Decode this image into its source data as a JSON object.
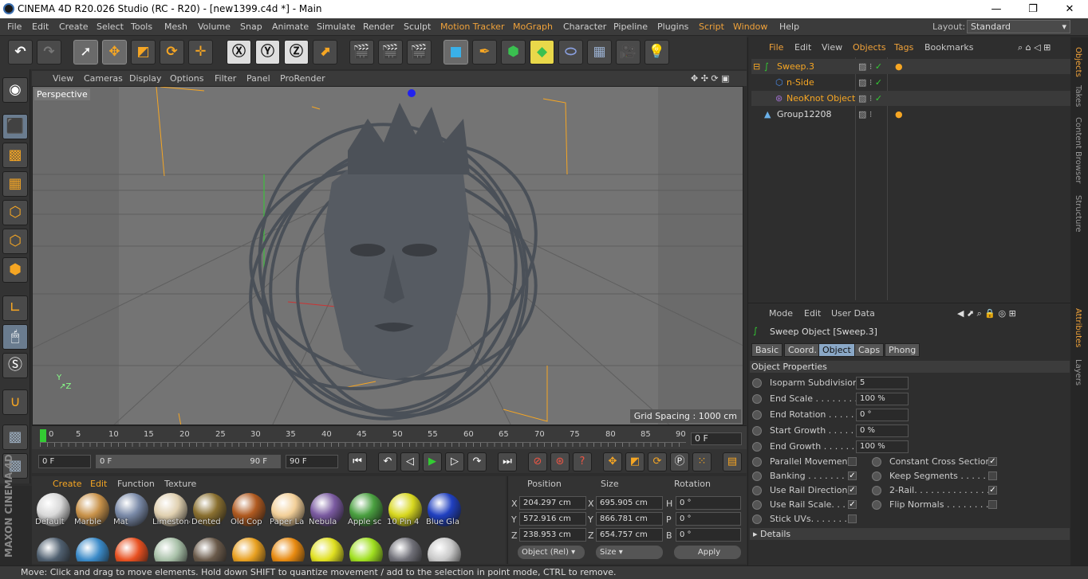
{
  "window": {
    "title": "CINEMA 4D R20.026 Studio (RC - R20) - [new1399.c4d *] - Main",
    "minimize": "—",
    "maximize": "❐",
    "close": "✕"
  },
  "menu": {
    "items": [
      "File",
      "Edit",
      "Create",
      "Select",
      "Tools",
      "Mesh",
      "Volume",
      "Snap",
      "Animate",
      "Simulate",
      "Render",
      "Sculpt",
      "Motion Tracker",
      "MoGraph",
      "Character",
      "Pipeline",
      "Plugins",
      "Script",
      "Window",
      "Help"
    ],
    "layout_label": "Layout:",
    "layout_value": "Standard"
  },
  "viewport": {
    "menu": [
      "View",
      "Cameras",
      "Display",
      "Options",
      "Filter",
      "Panel",
      "ProRender"
    ],
    "camera": "Perspective",
    "grid_spacing": "Grid Spacing : 1000 cm"
  },
  "timeline": {
    "ticks": [
      "0",
      "5",
      "10",
      "15",
      "20",
      "25",
      "30",
      "35",
      "40",
      "45",
      "50",
      "55",
      "60",
      "65",
      "70",
      "75",
      "80",
      "85",
      "90"
    ],
    "current_frame": "0 F"
  },
  "transport": {
    "start": "0 F",
    "range_start": "0 F",
    "range_end": "90 F",
    "end": "90 F"
  },
  "materials": {
    "menu": [
      "Create",
      "Edit",
      "Function",
      "Texture"
    ],
    "row1": [
      {
        "name": "Default",
        "color": "#d8d8d8"
      },
      {
        "name": "Marble",
        "color": "#c8924a"
      },
      {
        "name": "Mat",
        "color": "#7a8aa8"
      },
      {
        "name": "Limestone",
        "color": "#e0d0b0"
      },
      {
        "name": "Dented",
        "color": "#8a7030"
      },
      {
        "name": "Old Cop",
        "color": "#b05a20"
      },
      {
        "name": "Paper La",
        "color": "#f2cf98"
      },
      {
        "name": "Nebula",
        "color": "#7a5aa0"
      },
      {
        "name": "Apple sc",
        "color": "#4aa040"
      },
      {
        "name": "10 Pin 4",
        "color": "#d8d820"
      },
      {
        "name": "Blue Gla",
        "color": "#2040c0"
      }
    ],
    "row2": [
      {
        "color": "#506070"
      },
      {
        "color": "#3a8ac8"
      },
      {
        "color": "#e85020"
      },
      {
        "color": "#a8c0a8"
      },
      {
        "color": "#6a5a4a"
      },
      {
        "color": "#e8a020"
      },
      {
        "color": "#e88a10"
      },
      {
        "color": "#e0e020"
      },
      {
        "color": "#a0e020"
      },
      {
        "color": "#707078"
      },
      {
        "color": "#c8c8c8"
      }
    ]
  },
  "coords": {
    "headers": [
      "Position",
      "Size",
      "Rotation"
    ],
    "rows": [
      {
        "axis": "X",
        "pos": "204.297 cm",
        "size_axis": "X",
        "size": "695.905 cm",
        "rot_axis": "H",
        "rot": "0 °"
      },
      {
        "axis": "Y",
        "pos": "572.916 cm",
        "size_axis": "Y",
        "size": "866.781 cm",
        "rot_axis": "P",
        "rot": "0 °"
      },
      {
        "axis": "Z",
        "pos": "238.953 cm",
        "size_axis": "Z",
        "size": "654.757 cm",
        "rot_axis": "B",
        "rot": "0 °"
      }
    ],
    "mode": "Object (Rel)",
    "size_mode": "Size",
    "apply": "Apply"
  },
  "objects": {
    "menu": [
      "File",
      "Edit",
      "View",
      "Objects",
      "Tags",
      "Bookmarks"
    ],
    "tree": [
      {
        "name": "Sweep.3",
        "indent": 0
      },
      {
        "name": "n-Side",
        "indent": 1
      },
      {
        "name": "NeoKnot Object",
        "indent": 1
      },
      {
        "name": "Group12208",
        "indent": 0
      }
    ]
  },
  "attributes": {
    "menu": [
      "Mode",
      "Edit",
      "User Data"
    ],
    "object_title": "Sweep Object [Sweep.3]",
    "tabs": [
      "Basic",
      "Coord.",
      "Object",
      "Caps",
      "Phong"
    ],
    "section": "Object Properties",
    "fields": [
      {
        "label": "Isoparm Subdivision",
        "value": "5"
      },
      {
        "label": "End Scale . . . . . . . . .",
        "value": "100 %"
      },
      {
        "label": "End Rotation . . . . . .",
        "value": "0 °"
      },
      {
        "label": "Start Growth . . . . . .",
        "value": "0 %"
      },
      {
        "label": "End Growth . . . . . . .",
        "value": "100 %"
      }
    ],
    "checks_left": [
      {
        "label": "Parallel Movement",
        "checked": false
      },
      {
        "label": "Banking . . . . . . . .",
        "checked": true
      },
      {
        "label": "Use Rail Direction",
        "checked": true
      },
      {
        "label": "Use Rail Scale. . . .",
        "checked": true
      },
      {
        "label": "Stick UVs. . . . . . .",
        "checked": false
      }
    ],
    "checks_right": [
      {
        "label": "Constant Cross Section",
        "checked": true
      },
      {
        "label": "Keep Segments . . . . . .",
        "checked": false
      },
      {
        "label": "2-Rail. . . . . . . . . . . . . . .",
        "checked": true
      },
      {
        "label": "Flip Normals . . . . . . . . .",
        "checked": false
      }
    ],
    "details": "Details"
  },
  "side_tabs": [
    "Objects",
    "Takes",
    "Content Browser",
    "Structure",
    "Attributes",
    "Layers"
  ],
  "status": "Move: Click and drag to move elements. Hold down SHIFT to quantize movement / add to the selection in point mode, CTRL to remove.",
  "logo": "MAXON CINEMA 4D"
}
